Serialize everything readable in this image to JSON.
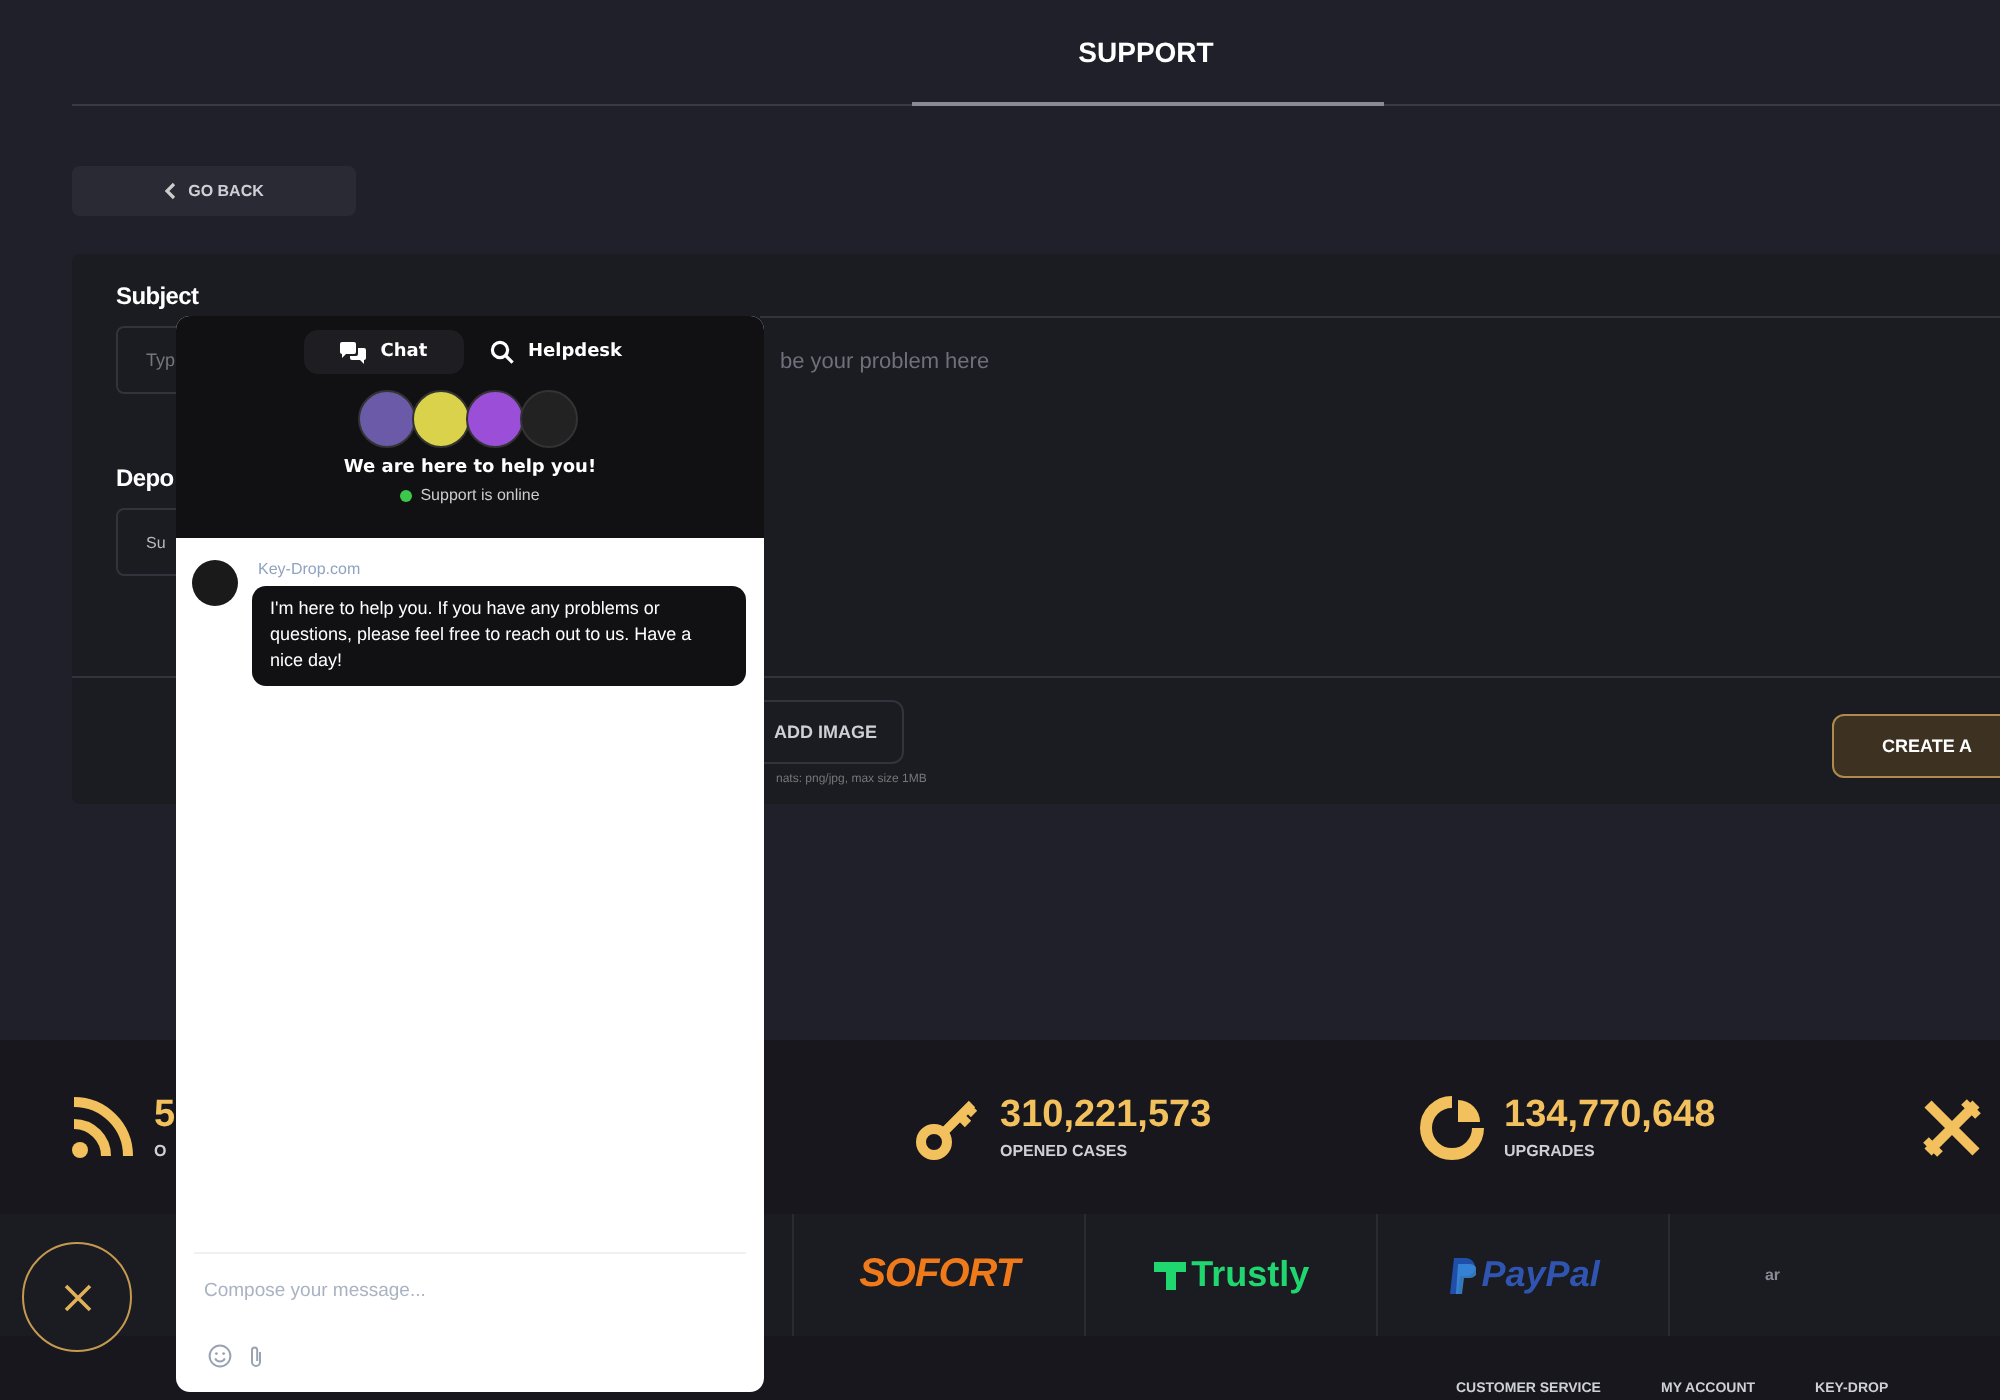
{
  "page": {
    "title": "SUPPORT",
    "back_button": "GO BACK"
  },
  "form": {
    "subject_label": "Subject",
    "subject_placeholder": "Typ",
    "department_label": "Depo",
    "department_value": "Su",
    "description_placeholder": "be your problem here",
    "add_image_button": "ADD IMAGE",
    "image_hint": "nats: png/jpg, max size 1MB",
    "create_button": "CREATE A"
  },
  "stats": [
    {
      "kind": "feed",
      "value": "5",
      "label": "O"
    },
    {
      "kind": "key",
      "value": "310,221,573",
      "label": "OPENED CASES"
    },
    {
      "kind": "upgrade",
      "value": "134,770,648",
      "label": "UPGRADES"
    },
    {
      "kind": "swords"
    }
  ],
  "payments": [
    {
      "name": "SOFORT",
      "color": "#f07a1a",
      "kind": "sofort"
    },
    {
      "name": "Trustly",
      "color": "#1fd66f",
      "kind": "trustly"
    },
    {
      "name": "PayPal",
      "color": "#2f55b0",
      "kind": "paypal"
    },
    {
      "name": "ar",
      "color": "#8a8a95",
      "kind": "text"
    }
  ],
  "footer_links": [
    "CUSTOMER SERVICE",
    "MY ACCOUNT",
    "KEY-DROP"
  ],
  "chat": {
    "tabs": [
      {
        "label": "Chat",
        "kind": "chat",
        "selected": true
      },
      {
        "label": "Helpdesk",
        "kind": "search",
        "selected": false
      }
    ],
    "heading": "We are here to help you!",
    "status": "Support is online",
    "online": true,
    "messages": [
      {
        "sender": "Key-Drop.com",
        "text": "I'm here to help you. If you have any problems or questions, please feel free to reach out to us. Have a nice day!"
      }
    ],
    "compose_placeholder": "Compose your message..."
  }
}
